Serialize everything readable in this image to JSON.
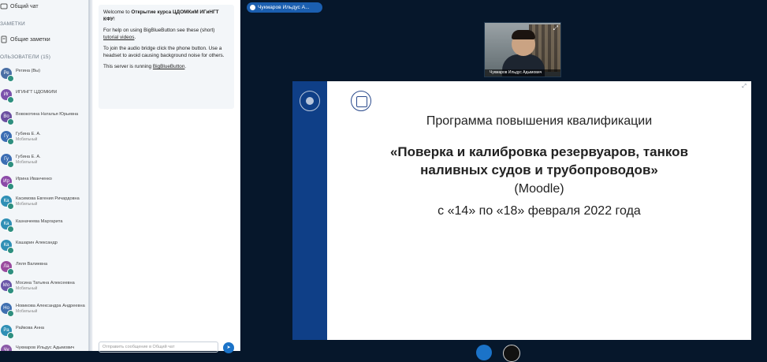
{
  "sidebar": {
    "public_chat": "Общий чат",
    "notes_header": "ЗАМЕТКИ",
    "shared_notes": "Общие заметки",
    "users_header": "ОЛЬЗОВАТЕЛИ (15)",
    "users": [
      {
        "initials": "Ре",
        "name": "Регина (Вы)",
        "sub": "",
        "color": "#4a6fa5"
      },
      {
        "initials": "Иг",
        "name": "ИГИНГТ ЦДОМКИМ",
        "sub": "",
        "color": "#7b52ab"
      },
      {
        "initials": "Во",
        "name": "Вовокотина Наталья Юрьевна",
        "sub": "",
        "color": "#6b4fa0"
      },
      {
        "initials": "Гу",
        "name": "Губина Е. А.",
        "sub": "Мобильный",
        "color": "#3b6db3"
      },
      {
        "initials": "Гу",
        "name": "Губина Е. А.",
        "sub": "Мобильный",
        "color": "#3b6db3"
      },
      {
        "initials": "Ир",
        "name": "Ирина Иванченко",
        "sub": "",
        "color": "#8b4aa8"
      },
      {
        "initials": "Ка",
        "name": "Касимова Евгения Ричардовна",
        "sub": "Мобильный",
        "color": "#2f8fb5"
      },
      {
        "initials": "Ка",
        "name": "Казначеева Маргарита",
        "sub": "",
        "color": "#2f8fb5"
      },
      {
        "initials": "Ка",
        "name": "Кашарин Александр",
        "sub": "",
        "color": "#2f8fb5"
      },
      {
        "initials": "Ла",
        "name": "Ляля Валиевна",
        "sub": "",
        "color": "#9a4a9e"
      },
      {
        "initials": "Мо",
        "name": "Мосина Татьяна Алексеевна",
        "sub": "Мобильный",
        "color": "#6a56a8"
      },
      {
        "initials": "Но",
        "name": "Новикова Александра Андреевна",
        "sub": "Мобильный",
        "color": "#3f6fb0"
      },
      {
        "initials": "Ра",
        "name": "Райкова Анна",
        "sub": "",
        "color": "#2f8fb5"
      },
      {
        "initials": "Чу",
        "name": "Чукмаров Ильдус Адымович",
        "sub": "",
        "color": "#8b5aa8"
      }
    ]
  },
  "chat": {
    "welcome_prefix": "Welcome to ",
    "welcome_title": "Открытие курса ЦДОМКиМ ИГиНГТ КФУ",
    "welcome_suffix": "!",
    "help_text": "For help on using BigBlueButton see these (short) ",
    "help_link": "tutorial videos",
    "help_end": ".",
    "audio_text": "To join the audio bridge click the phone button. Use a headset to avoid causing background noise for others.",
    "server_prefix": "This server is running ",
    "server_link": "BigBlueButton",
    "server_end": ".",
    "input_placeholder": "Отправить сообщение в Общий чат"
  },
  "presenter": {
    "pill_label": "Чукмаров Ильдус А..."
  },
  "webcam": {
    "label": "Чукмаров Ильдус Адымович"
  },
  "slide": {
    "line1": "Программа повышения квалификации",
    "line2": "«Поверка и калибровка резервуаров, танков",
    "line3": "наливных судов и трубопроводов»",
    "line4": "(Moodle)",
    "line5": "с «14» по «18» февраля 2022 года"
  },
  "colors": {
    "background": "#06172b",
    "accent": "#1b73c8",
    "slide_band": "#0f3f87"
  }
}
